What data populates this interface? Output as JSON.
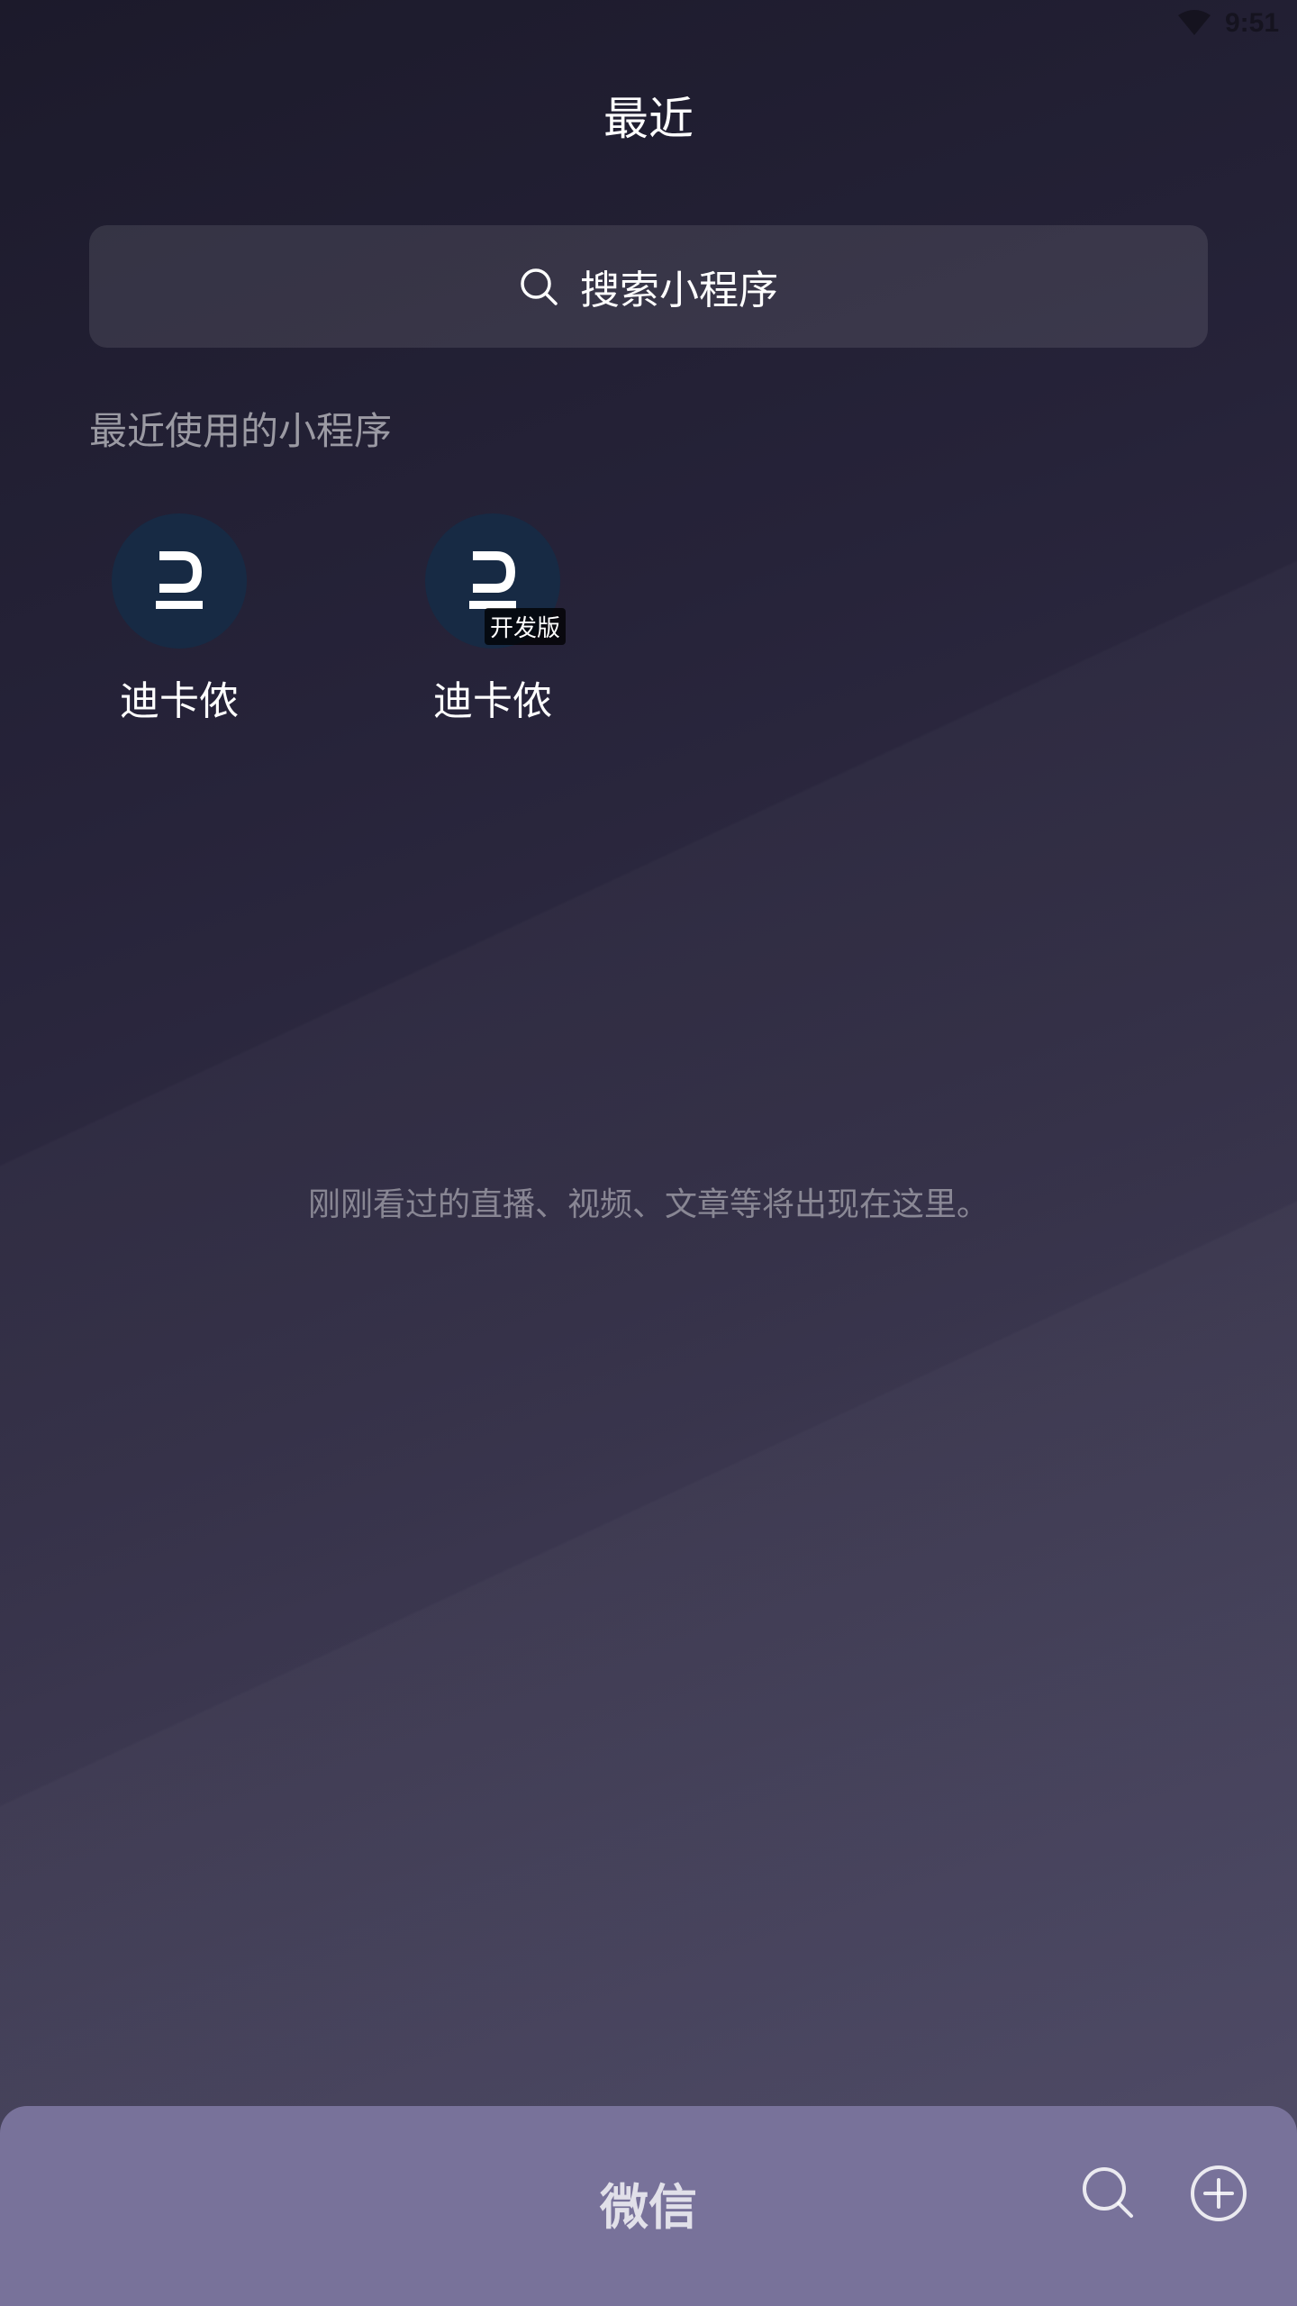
{
  "status_bar": {
    "time": "9:51",
    "wifi_icon": "wifi-icon"
  },
  "page": {
    "title": "最近"
  },
  "search": {
    "label": "搜索小程序",
    "icon": "search-icon"
  },
  "recent_mini_programs": {
    "heading": "最近使用的小程序",
    "items": [
      {
        "name": "迪卡侬",
        "badge": ""
      },
      {
        "name": "迪卡侬",
        "badge": "开发版"
      }
    ]
  },
  "empty_state": {
    "text": "刚刚看过的直播、视频、文章等将出现在这里。"
  },
  "bottom_bar": {
    "title": "微信",
    "search_icon": "search-icon",
    "add_icon": "plus-circle-icon"
  },
  "colors": {
    "bottom_bar": "#78729a",
    "app_logo_bg": "#172a44"
  }
}
